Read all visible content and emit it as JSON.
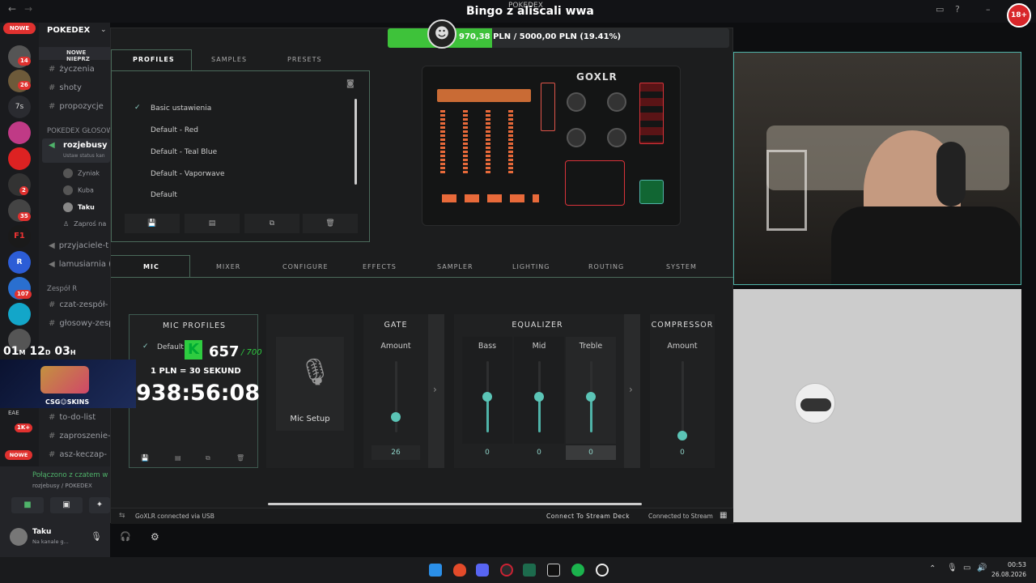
{
  "stream": {
    "title": "Bingo z aliscali wwa",
    "small_title": "POKEDEX",
    "donation_goal": "970,38 PLN / 5000,00 PLN (19.41%)",
    "donation_progress": 0.1941,
    "csgo_label": "CSG☺SKINS",
    "timer_day_label": "01",
    "timer_m": "M",
    "timer_d_num": "12",
    "timer_d": "D",
    "timer_h_num": "03",
    "timer_h": "H",
    "points_value": "657",
    "points_max": "/ 700",
    "rate_text": "1 PLN = 30 SEKUND",
    "countdown": "938:56:08",
    "age_badge": "18+"
  },
  "discord": {
    "server_name": "POKEDEX",
    "banner_new": "NOWE",
    "notice": "NOWE NIEPRZ",
    "channels": [
      "życzenia",
      "shoty",
      "propozycje"
    ],
    "voice_category": "POKEDEX GŁOSOW",
    "active_voice": "rozjebusy",
    "active_voice_status": "Ustaw status kan",
    "voice_users": [
      "Zyniak",
      "Kuba",
      "Taku"
    ],
    "invite": "Zaproś na",
    "channels2": [
      "przyjaciele-t",
      "lamusiarnia ("
    ],
    "category2": "Zespół R",
    "channels3": [
      "czat-zespół-",
      "głosowy-zesp",
      "to-do-list",
      "zaproszenie-",
      "asz-keczap-"
    ],
    "connection": "Połączono z czatem w",
    "connection_sub": "rozjebusy / POKEDEX",
    "user_name": "Taku",
    "user_status": "Na kanale g...",
    "badges": [
      "14",
      "26",
      "7s",
      "2",
      "2",
      "35",
      "107",
      "1K+",
      "EAE",
      "NOWE"
    ]
  },
  "goxlr": {
    "top_tabs": [
      "PROFILES",
      "SAMPLES",
      "PRESETS"
    ],
    "profiles": [
      "Basic ustawienia",
      "Default - Red",
      "Default - Teal Blue",
      "Default - Vaporwave",
      "Default"
    ],
    "selected_profile": "Basic ustawienia",
    "main_tabs": [
      "MIC",
      "MIXER",
      "CONFIGURE",
      "EFFECTS",
      "SAMPLER",
      "LIGHTING",
      "ROUTING",
      "SYSTEM"
    ],
    "mic_profiles_title": "MIC PROFILES",
    "mic_profile_selected": "Default",
    "mic_setup_label": "Mic Setup",
    "gate": {
      "title": "GATE",
      "label": "Amount",
      "value": "26",
      "level": 0.26
    },
    "equalizer": {
      "title": "EQUALIZER",
      "bands": [
        {
          "label": "Bass",
          "value": "0",
          "level": 0.5
        },
        {
          "label": "Mid",
          "value": "0",
          "level": 0.5
        },
        {
          "label": "Treble",
          "value": "0",
          "level": 0.5
        }
      ]
    },
    "compressor": {
      "title": "COMPRESSOR",
      "label": "Amount",
      "value": "0",
      "level": 0.0
    },
    "logo": "GOXLR",
    "status_left": "GoXLR connected via USB",
    "status_mid": "Connect To Stream Deck",
    "status_right": "Connected to Stream"
  },
  "taskbar": {
    "time": "00:53",
    "date": "26.08.2026"
  },
  "colors": {
    "accent": "#4fb3a8",
    "discord_red": "#e0312f",
    "donation_green": "#3ec23a"
  }
}
